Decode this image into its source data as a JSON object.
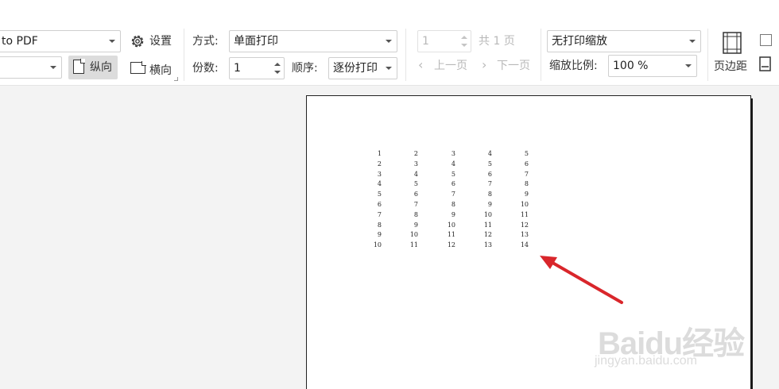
{
  "printer": {
    "name": "to PDF",
    "paper": ""
  },
  "orientation": {
    "portrait_label": "纵向",
    "landscape_label": "横向"
  },
  "settings_label": "设置",
  "print_mode": {
    "label": "方式:",
    "value": "单面打印"
  },
  "copies": {
    "label": "份数:",
    "value": "1"
  },
  "order": {
    "label": "顺序:",
    "value": "逐份打印"
  },
  "page_nav": {
    "current": "1",
    "total_text": "共 1 页",
    "prev_label": "上一页",
    "next_label": "下一页"
  },
  "scaling": {
    "mode": "无打印缩放",
    "ratio_label": "缩放比例:",
    "ratio_value": "100 %"
  },
  "margins_label": "页边距",
  "sheet_columns": [
    [
      "1",
      "2",
      "3",
      "4",
      "5",
      "6",
      "7",
      "8",
      "9",
      "10"
    ],
    [
      "2",
      "3",
      "4",
      "5",
      "6",
      "7",
      "8",
      "9",
      "10",
      "11"
    ],
    [
      "3",
      "4",
      "5",
      "6",
      "7",
      "8",
      "9",
      "10",
      "11",
      "12"
    ],
    [
      "4",
      "5",
      "6",
      "7",
      "8",
      "9",
      "10",
      "11",
      "12",
      "13"
    ],
    [
      "5",
      "6",
      "7",
      "8",
      "9",
      "10",
      "11",
      "12",
      "13",
      "14"
    ]
  ],
  "watermark": {
    "logo": "Baidu经验",
    "url": "jingyan.baidu.com"
  },
  "colors": {
    "arrow": "#d9262b",
    "selected_button": "#dcdcdc",
    "page_border": "#222222"
  }
}
